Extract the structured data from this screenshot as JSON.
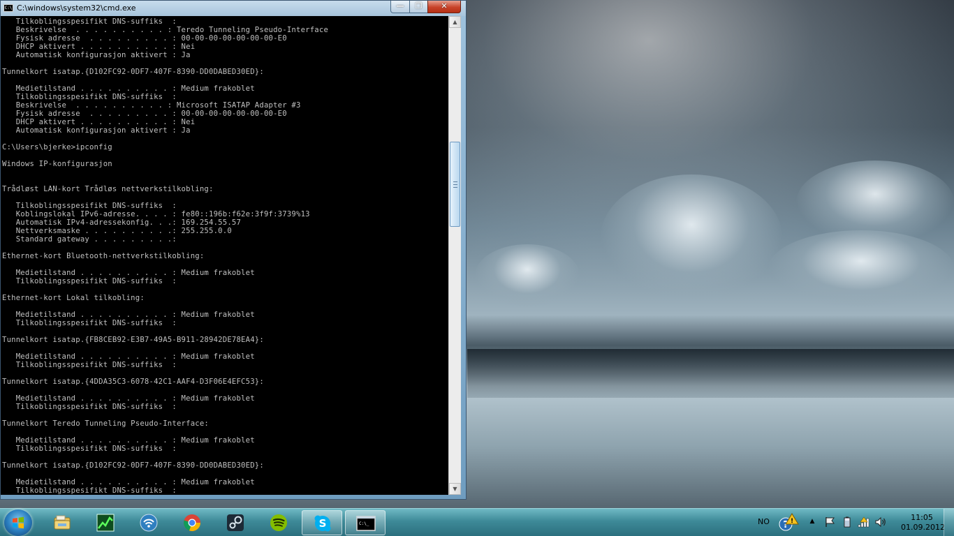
{
  "window": {
    "title": "C:\\windows\\system32\\cmd.exe",
    "icon_text": "C:\\",
    "minimize_glyph": "—",
    "maximize_glyph": "❐",
    "close_glyph": "✕"
  },
  "console": {
    "text": "   Tilkoblingsspesifikt DNS-suffiks  :\n   Beskrivelse  . . . . . . . . . . : Teredo Tunneling Pseudo-Interface\n   Fysisk adresse  . . . . . . . . . : 00-00-00-00-00-00-00-E0\n   DHCP aktivert . . . . . . . . . . : Nei\n   Automatisk konfigurasjon aktivert : Ja\n\nTunnelkort isatap.{D102FC92-0DF7-407F-8390-DD0DABED30ED}:\n\n   Medietilstand . . . . . . . . . . : Medium frakoblet\n   Tilkoblingsspesifikt DNS-suffiks  :\n   Beskrivelse  . . . . . . . . . . : Microsoft ISATAP Adapter #3\n   Fysisk adresse  . . . . . . . . . : 00-00-00-00-00-00-00-E0\n   DHCP aktivert . . . . . . . . . . : Nei\n   Automatisk konfigurasjon aktivert : Ja\n\nC:\\Users\\bjerke>ipconfig\n\nWindows IP-konfigurasjon\n\n\nTrådløst LAN-kort Trådløs nettverkstilkobling:\n\n   Tilkoblingsspesifikt DNS-suffiks  :\n   Koblingslokal IPv6-adresse. . . . : fe80::196b:f62e:3f9f:3739%13\n   Automatisk IPv4-adressekonfig. . .: 169.254.55.57\n   Nettverksmaske . . . . . . . . . .: 255.255.0.0\n   Standard gateway . . . . . . . . .:\n\nEthernet-kort Bluetooth-nettverkstilkobling:\n\n   Medietilstand . . . . . . . . . . : Medium frakoblet\n   Tilkoblingsspesifikt DNS-suffiks  :\n\nEthernet-kort Lokal tilkobling:\n\n   Medietilstand . . . . . . . . . . : Medium frakoblet\n   Tilkoblingsspesifikt DNS-suffiks  :\n\nTunnelkort isatap.{FB8CEB92-E3B7-49A5-B911-28942DE78EA4}:\n\n   Medietilstand . . . . . . . . . . : Medium frakoblet\n   Tilkoblingsspesifikt DNS-suffiks  :\n\nTunnelkort isatap.{4DDA35C3-6078-42C1-AAF4-D3F06E4EFC53}:\n\n   Medietilstand . . . . . . . . . . : Medium frakoblet\n   Tilkoblingsspesifikt DNS-suffiks  :\n\nTunnelkort Teredo Tunneling Pseudo-Interface:\n\n   Medietilstand . . . . . . . . . . : Medium frakoblet\n   Tilkoblingsspesifikt DNS-suffiks  :\n\nTunnelkort isatap.{D102FC92-0DF7-407F-8390-DD0DABED30ED}:\n\n   Medietilstand . . . . . . . . . . : Medium frakoblet\n   Tilkoblingsspesifikt DNS-suffiks  :",
    "text_color": "#c0c0c0",
    "background_color": "#000000"
  },
  "scrollbar": {
    "up_glyph": "▲",
    "down_glyph": "▼"
  },
  "taskbar": {
    "pinned": [
      {
        "name": "windows-explorer-icon"
      },
      {
        "name": "task-manager-icon"
      },
      {
        "name": "network-monitor-icon"
      },
      {
        "name": "google-chrome-icon"
      },
      {
        "name": "steam-icon"
      },
      {
        "name": "spotify-icon"
      },
      {
        "name": "skype-icon"
      },
      {
        "name": "command-prompt-icon"
      }
    ],
    "cmd_icon_text": "C:\\_",
    "language": "NO",
    "tray": [
      {
        "name": "action-center-icon"
      },
      {
        "name": "show-hidden-icons-icon"
      },
      {
        "name": "flag-icon"
      },
      {
        "name": "battery-icon"
      },
      {
        "name": "wifi-signal-icon"
      },
      {
        "name": "volume-icon"
      }
    ],
    "show_hidden_glyph": "▲",
    "clock": {
      "time": "11:05",
      "date": "01.09.2012"
    }
  }
}
